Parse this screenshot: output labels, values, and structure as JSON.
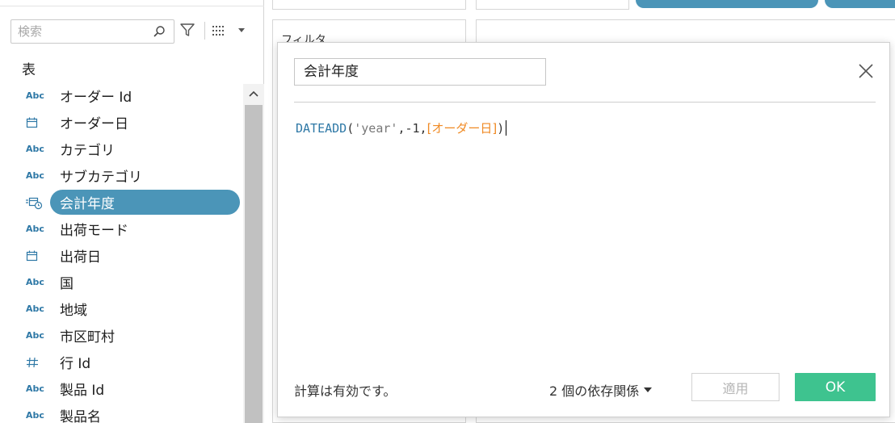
{
  "left_pane": {
    "search_placeholder": "検索",
    "section_title": "表",
    "fields": [
      {
        "type": "Abc",
        "icon": "string-type",
        "label": "オーダー Id"
      },
      {
        "type": "",
        "icon": "calendar-icon",
        "label": "オーダー日"
      },
      {
        "type": "Abc",
        "icon": "string-type",
        "label": "カテゴリ"
      },
      {
        "type": "Abc",
        "icon": "string-type",
        "label": "サブカテゴリ"
      },
      {
        "type": "",
        "icon": "calculated-date-icon",
        "label": "会計年度",
        "selected": true
      },
      {
        "type": "Abc",
        "icon": "string-type",
        "label": "出荷モード"
      },
      {
        "type": "",
        "icon": "calendar-icon",
        "label": "出荷日"
      },
      {
        "type": "Abc",
        "icon": "string-type",
        "label": "国"
      },
      {
        "type": "Abc",
        "icon": "string-type",
        "label": "地域"
      },
      {
        "type": "Abc",
        "icon": "string-type",
        "label": "市区町村"
      },
      {
        "type": "",
        "icon": "number-hash-icon",
        "label": "行 Id"
      },
      {
        "type": "Abc",
        "icon": "string-type",
        "label": "製品 Id"
      },
      {
        "type": "Abc",
        "icon": "string-type",
        "label": "製品名"
      }
    ]
  },
  "background": {
    "filter_card_title": "フィルタ"
  },
  "dialog": {
    "calc_name": "会計年度",
    "formula": {
      "fn": "DATEADD",
      "open": "(",
      "arg1": "'year'",
      "comma1": ",",
      "arg2": "-1",
      "comma2": ",",
      "field_ref": "[オーダー日]",
      "close": ")"
    },
    "status": "計算は有効です。",
    "dependencies": "2 個の依存関係",
    "apply_label": "適用",
    "ok_label": "OK"
  },
  "colors": {
    "accent": "#4b95b8",
    "ok_green": "#3ec38f",
    "field_ref_orange": "#f08a24",
    "function_blue": "#2e78a6"
  }
}
